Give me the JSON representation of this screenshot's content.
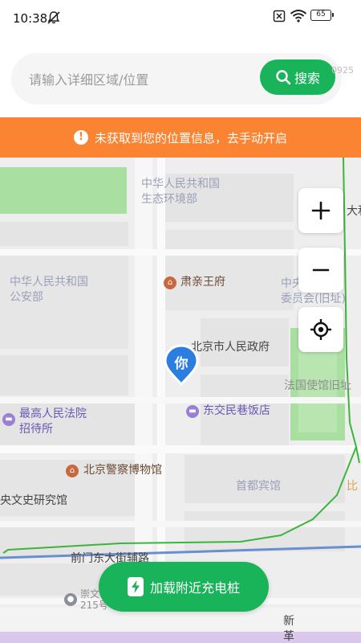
{
  "status_bar": {
    "time": "10:38",
    "battery": "65"
  },
  "search": {
    "placeholder": "请输入详细区域/位置",
    "button_label": "搜索",
    "suffix": "0925"
  },
  "banner": {
    "text": "未获取到您的位置信息，去手动开启"
  },
  "map": {
    "labels": {
      "eco_ministry": "中华人民共和国\n生态环境部",
      "public_security": "中华人民共和国\n公安部",
      "committee": "中央\n委员会(旧址)",
      "dami_right": "大和",
      "suqin_palace": "肃亲王府",
      "bj_gov": "北京市人民政府",
      "french_embassy": "法国使馆旧址",
      "supreme_court": "最高人民法院\n招待所",
      "dongjiao_hotel": "东交民巷饭店",
      "police_museum": "北京警察博物馆",
      "capital_hotel": "首都宾馆",
      "bi": "比",
      "culture_institute": "央文史研究馆",
      "qianmen_road": "前门东大街辅路",
      "chongwen": "崇文\n215号",
      "xinge": "新\n革"
    },
    "user_marker": "你"
  },
  "load_button": {
    "label": "加载附近充电桩"
  }
}
